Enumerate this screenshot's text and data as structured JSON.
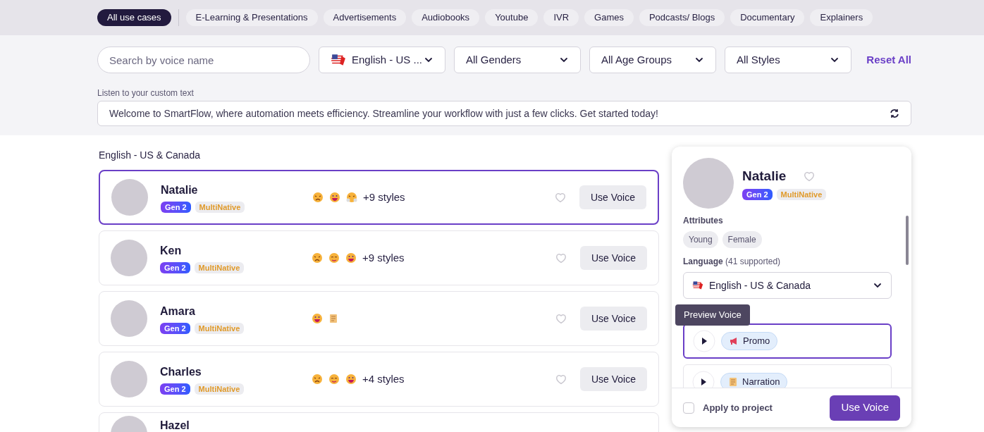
{
  "use_cases": [
    {
      "label": "All use cases",
      "selected": true
    },
    {
      "label": "E-Learning & Presentations",
      "selected": false
    },
    {
      "label": "Advertisements",
      "selected": false
    },
    {
      "label": "Audiobooks",
      "selected": false
    },
    {
      "label": "Youtube",
      "selected": false
    },
    {
      "label": "IVR",
      "selected": false
    },
    {
      "label": "Games",
      "selected": false
    },
    {
      "label": "Podcasts/ Blogs",
      "selected": false
    },
    {
      "label": "Documentary",
      "selected": false
    },
    {
      "label": "Explainers",
      "selected": false
    }
  ],
  "filters": {
    "search_placeholder": "Search by voice name",
    "dropdowns": [
      {
        "label": "English - US ...",
        "flag": true
      },
      {
        "label": "All Genders",
        "flag": false
      },
      {
        "label": "All Age Groups",
        "flag": false
      },
      {
        "label": "All Styles",
        "flag": false
      }
    ],
    "reset": "Reset All"
  },
  "custom_text": {
    "label": "Listen to your custom text",
    "value": "Welcome to SmartFlow, where automation meets efficiency. Streamline your workflow with just a few clicks. Get started today!"
  },
  "section_title": "English - US & Canada",
  "voices": [
    {
      "name": "Natalie",
      "badges": [
        "Gen 2",
        "MultiNative"
      ],
      "style_icons": [
        {
          "kind": "frown"
        },
        {
          "kind": "grin"
        },
        {
          "kind": "steam"
        }
      ],
      "more": "+9 styles",
      "button": "Use Voice",
      "selected": true
    },
    {
      "name": "Ken",
      "badges": [
        "Gen 2",
        "MultiNative"
      ],
      "style_icons": [
        {
          "kind": "frown"
        },
        {
          "kind": "calm"
        },
        {
          "kind": "grin"
        }
      ],
      "more": "+9 styles",
      "button": "Use Voice",
      "selected": false
    },
    {
      "name": "Amara",
      "badges": [
        "Gen 2",
        "MultiNative"
      ],
      "style_icons": [
        {
          "kind": "grin"
        },
        {
          "kind": "scroll"
        }
      ],
      "button": "Use Voice",
      "selected": false
    },
    {
      "name": "Charles",
      "badges": [
        "Gen 2",
        "MultiNative"
      ],
      "style_icons": [
        {
          "kind": "frown"
        },
        {
          "kind": "calm"
        },
        {
          "kind": "grin"
        }
      ],
      "more": "+4 styles",
      "button": "Use Voice",
      "selected": false
    },
    {
      "name": "Hazel",
      "selected": false
    }
  ],
  "detail": {
    "name": "Natalie",
    "badges": [
      "Gen 2",
      "MultiNative"
    ],
    "attributes_title": "Attributes",
    "attributes": [
      "Young",
      "Female"
    ],
    "language_label": "Language",
    "language_count": "(41 supported)",
    "language": "English - US & Canada",
    "tooltip": "Preview Voice",
    "styles": [
      {
        "label": "Promo",
        "kind": "megaphone",
        "selected": true
      },
      {
        "label": "Narration",
        "kind": "scroll",
        "selected": false
      }
    ],
    "apply_label": "Apply to project",
    "apply_checked": false,
    "button": "Use Voice"
  }
}
